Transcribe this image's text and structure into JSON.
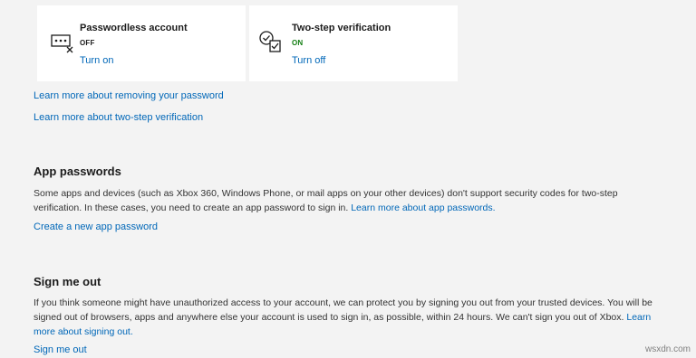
{
  "cards": {
    "passwordless": {
      "title": "Passwordless account",
      "status": "OFF",
      "action": "Turn on",
      "icon": "password-dots-icon"
    },
    "two_step": {
      "title": "Two-step verification",
      "status": "ON",
      "action": "Turn off",
      "icon": "verified-check-icon"
    }
  },
  "links": {
    "remove_password": "Learn more about removing your password",
    "two_step_learn": "Learn more about two-step verification"
  },
  "app_passwords": {
    "heading": "App passwords",
    "text": "Some apps and devices (such as Xbox 360, Windows Phone, or mail apps on your other devices) don't support security codes for two-step verification. In these cases, you need to create an app password to sign in.",
    "inline_link": "Learn more about app passwords.",
    "create_link": "Create a new app password"
  },
  "sign_out": {
    "heading": "Sign me out",
    "text": "If you think someone might have unauthorized access to your account, we can protect you by signing you out from your trusted devices. You will be signed out of browsers, apps and anywhere else your account is used to sign in, as possible, within 24 hours. We can't sign you out of Xbox.",
    "inline_link": "Learn more about signing out.",
    "action_link": "Sign me out"
  },
  "watermark": "wsxdn.com",
  "colors": {
    "link": "#0067b8",
    "status_on": "#107c10",
    "background": "#f3f3f3",
    "card": "#ffffff"
  }
}
